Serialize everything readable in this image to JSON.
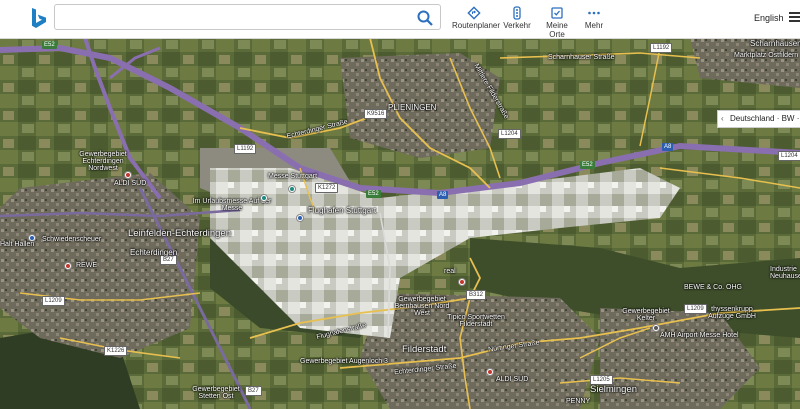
{
  "search": {
    "value": "",
    "placeholder": ""
  },
  "nav": [
    {
      "label": "Routenplaner",
      "icon": "route-diamond-icon"
    },
    {
      "label": "Verkehr",
      "icon": "traffic-light-icon"
    },
    {
      "label": "Meine Orte",
      "icon": "bookmark-check-icon"
    },
    {
      "label": "Mehr",
      "icon": "more-dots-icon"
    }
  ],
  "language": "English",
  "location_chip": "Deutschland · BW ·",
  "colors": {
    "motorway": "#8a6fb0",
    "road": "#e8c050",
    "field_dark": "#46552f",
    "field_light": "#7d8a4a"
  },
  "road_badges": {
    "e52_a": "E52",
    "e52_b": "E52",
    "e52_c": "E52",
    "a8_a": "A8",
    "a8_b": "A8",
    "k9516": "K9516",
    "l1192": "L1192",
    "l1204_a": "L1204",
    "l1204_b": "L1204",
    "k1272": "K1272",
    "b27_a": "B27",
    "b27_b": "B27",
    "b312": "B312",
    "l1209_a": "L1209",
    "l1209_b": "L1209",
    "k1226": "K1226",
    "l1205": "L1205"
  },
  "labels": {
    "scharnhausen": "Scharnhausen",
    "marktplatz": "Marktplatz Ostfildern",
    "scharnhauser_str": "Scharnhauser Straße",
    "plieningen": "PLIENINGEN",
    "echterdinger_str": "Echterdinger Straße",
    "mittlere_filderstr": "Mittlere Filderstraße",
    "gewerbe_nw": "Gewerbegebiet Echterdingen Nordwest",
    "aldi_nord": "ALDI SÜD",
    "messe": "Messe Stuttgart",
    "urlaub": "Im Urlaubsmesse Auf der Messe",
    "flughafen": "Flughafen Stuttgart",
    "leinfelden": "Leinfelden-Echterdingen",
    "echterdingen": "Echterdingen",
    "schwiedenscheuer": "Schwiedenscheuer",
    "rewe": "REWE",
    "halt": "Halt Hallen",
    "real": "real",
    "gewerbe_bern": "Gewerbegebiet Bernhausen Nord West",
    "tipico": "Tipico Sportwetten Filderstadt",
    "filderstadt": "Filderstadt",
    "nuertinger_str": "Nürtinger Straße",
    "aldi_sued": "ALDI SÜD",
    "gewerbe_aug": "Gewerbegebiet Augenloch 3",
    "gewerbe_steb": "Gewerbegebiet Stetten Ost",
    "flughafenstr": "Flughafenstraße",
    "echterdinger_str2": "Echterdinger Straße",
    "kelter": "Gewerbegebiet Kelter",
    "bewe": "BEWE & Co. OHG",
    "thyssen": "thyssenkrupp Aufzüge GmbH",
    "industrie": "Industrie Neuhause",
    "amh": "AMH Airport Messe Hotel",
    "sielmingen": "Sielmingen",
    "penny": "PENNY"
  }
}
